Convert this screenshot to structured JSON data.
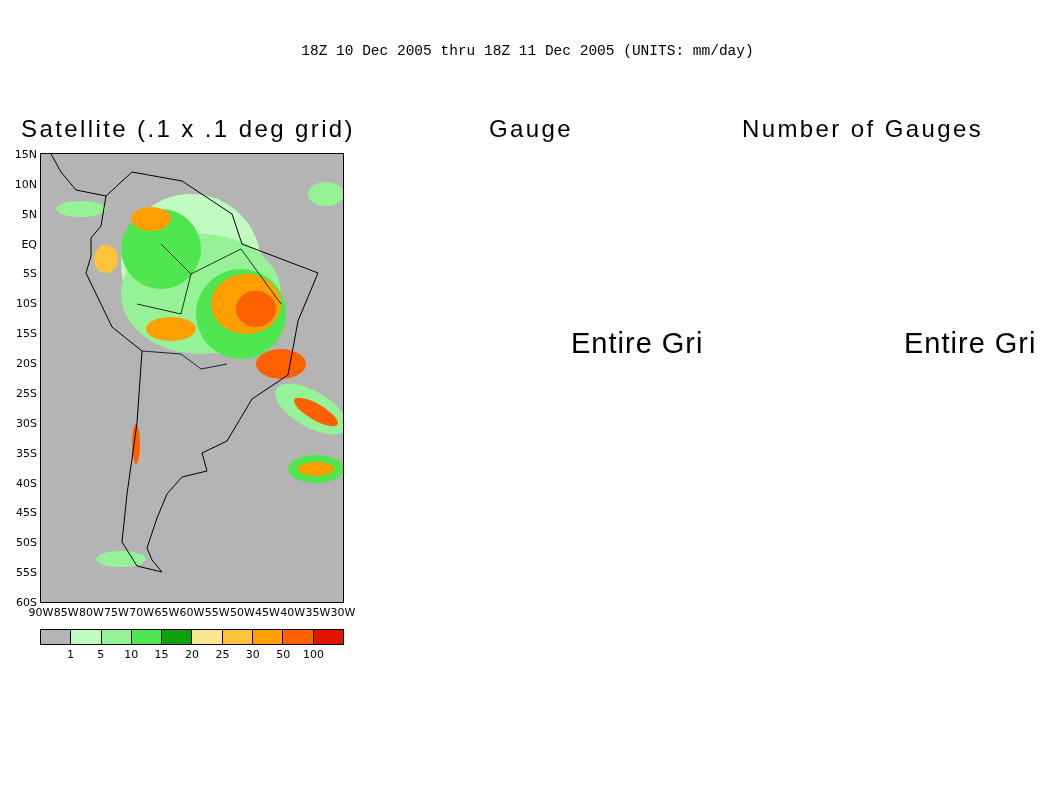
{
  "title": "18Z 10 Dec 2005 thru 18Z 11 Dec 2005 (UNITS: mm/day)",
  "panels": [
    {
      "kind": "map",
      "title": "Satellite (.1 x .1 deg grid)",
      "y_labels": [
        "15N",
        "10N",
        "5N",
        "EQ",
        "5S",
        "10S",
        "15S",
        "20S",
        "25S",
        "30S",
        "35S",
        "40S",
        "45S",
        "50S",
        "55S",
        "60S"
      ],
      "x_labels": [
        "90W",
        "85W",
        "80W",
        "75W",
        "70W",
        "65W",
        "60W",
        "55W",
        "50W",
        "45W",
        "40W",
        "35W",
        "30W"
      ],
      "colorbar": {
        "colors": [
          {
            "color": "#b4b4b4"
          },
          {
            "color": "#c1fbc1"
          },
          {
            "color": "#96f296"
          },
          {
            "color": "#50e650"
          },
          {
            "color": "#0fa00f"
          },
          {
            "color": "#fae68c"
          },
          {
            "color": "#ffc43c"
          },
          {
            "color": "#ffa000"
          },
          {
            "color": "#ff6000"
          },
          {
            "color": "#e11400"
          }
        ],
        "labels": [
          "1",
          "5",
          "10",
          "15",
          "20",
          "25",
          "30",
          "50",
          "100"
        ]
      }
    },
    {
      "kind": "empty",
      "title": "Gauge",
      "message": "Entire Gri"
    },
    {
      "kind": "empty",
      "title": "Number of Gauges",
      "message": "Entire Gri"
    }
  ]
}
